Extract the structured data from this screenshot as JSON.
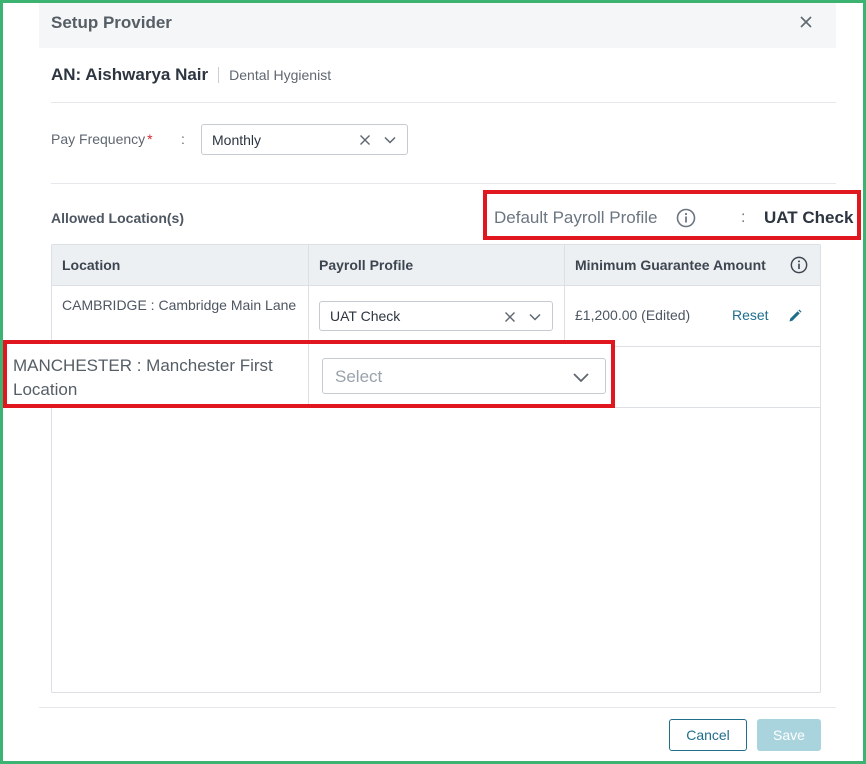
{
  "dialog": {
    "title": "Setup Provider"
  },
  "provider": {
    "name": "AN: Aishwarya Nair",
    "role": "Dental Hygienist"
  },
  "pay_frequency": {
    "label": "Pay Frequency",
    "required_mark": "*",
    "separator": ":",
    "value": "Monthly"
  },
  "allowed_locations": {
    "title": "Allowed Location(s)"
  },
  "default_payroll_profile": {
    "label": "Default Payroll Profile",
    "separator": ":",
    "value": "UAT Check"
  },
  "table": {
    "columns": [
      "Location",
      "Payroll Profile",
      "Minimum Guarantee Amount"
    ],
    "rows": [
      {
        "location": "CAMBRIDGE : Cambridge Main Lane",
        "payroll_profile": "UAT Check",
        "amount": "£1,200.00 (Edited)",
        "reset_label": "Reset"
      },
      {
        "location": "MANCHESTER : Manchester First Location",
        "payroll_profile_placeholder": "Select"
      }
    ]
  },
  "footer": {
    "cancel_label": "Cancel",
    "save_label": "Save"
  },
  "colors": {
    "accent": "#1f6f8b",
    "highlight": "#e0171f",
    "frame": "#3cb371",
    "save_disabled": "#a9d3dd",
    "required": "#d9262c"
  },
  "icons": [
    "close-icon",
    "clear-icon",
    "chevron-down-icon",
    "info-icon",
    "pencil-icon"
  ]
}
